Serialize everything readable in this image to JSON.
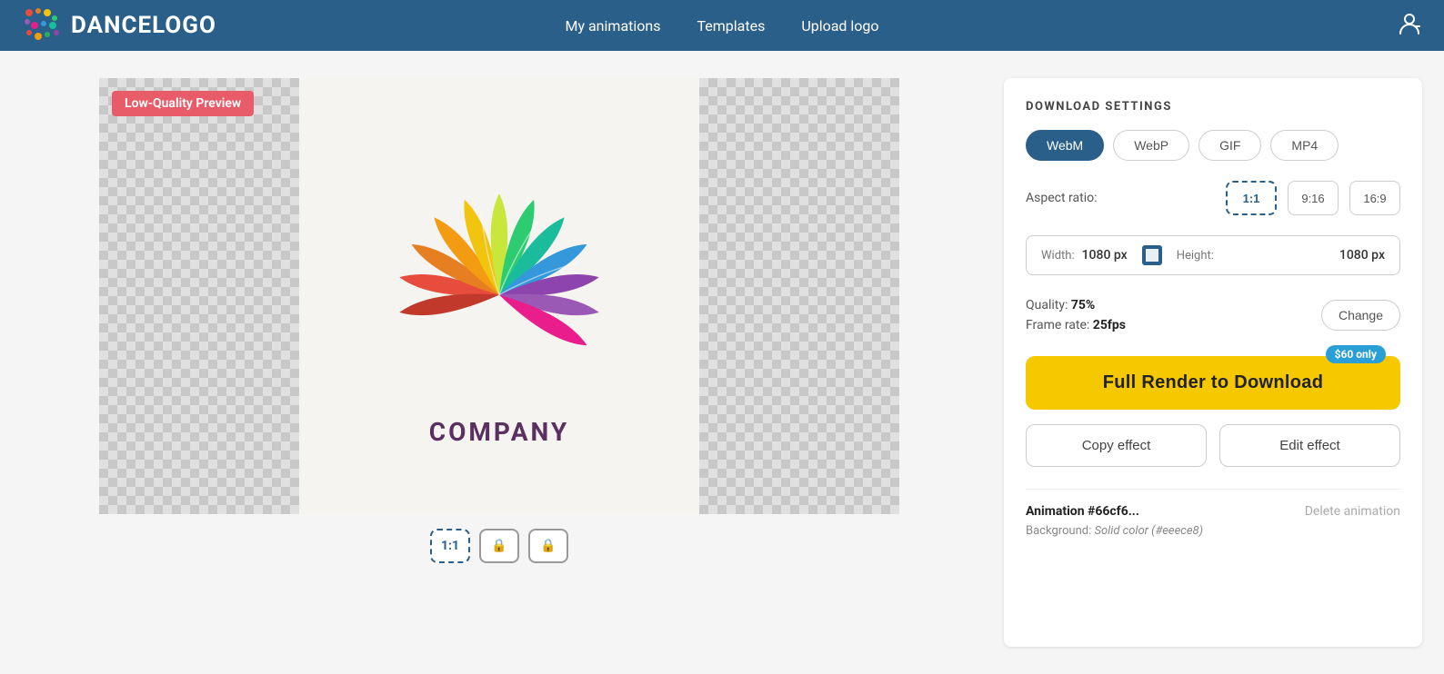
{
  "header": {
    "logo_text": "DANCELOGO",
    "nav": {
      "my_animations": "My animations",
      "templates": "Templates",
      "upload_logo": "Upload logo"
    }
  },
  "preview": {
    "low_quality_label": "Low-Quality Preview",
    "company_name": "COMPANY",
    "controls": {
      "ratio_1_1": "1:1",
      "lock1": "🔒",
      "lock2": "🔒"
    }
  },
  "settings": {
    "title": "DOWNLOAD SETTINGS",
    "formats": [
      "WebM",
      "WebP",
      "GIF",
      "MP4"
    ],
    "active_format": "WebM",
    "aspect_ratio_label": "Aspect ratio:",
    "aspect_ratios": [
      "1:1",
      "9:16",
      "16:9"
    ],
    "active_aspect": "1:1",
    "width_label": "Width:",
    "width_value": "1080 px",
    "height_label": "Height:",
    "height_value": "1080 px",
    "quality_label": "Quality:",
    "quality_value": "75%",
    "framerate_label": "Frame rate:",
    "framerate_value": "25fps",
    "change_btn": "Change",
    "price_badge": "$60 only",
    "download_btn": "Full Render to Download",
    "copy_btn": "Copy effect",
    "edit_btn": "Edit effect",
    "animation_id": "Animation #66cf6...",
    "delete_link": "Delete animation",
    "background_label": "Background:",
    "background_value": "Solid color (#eeece8)"
  }
}
